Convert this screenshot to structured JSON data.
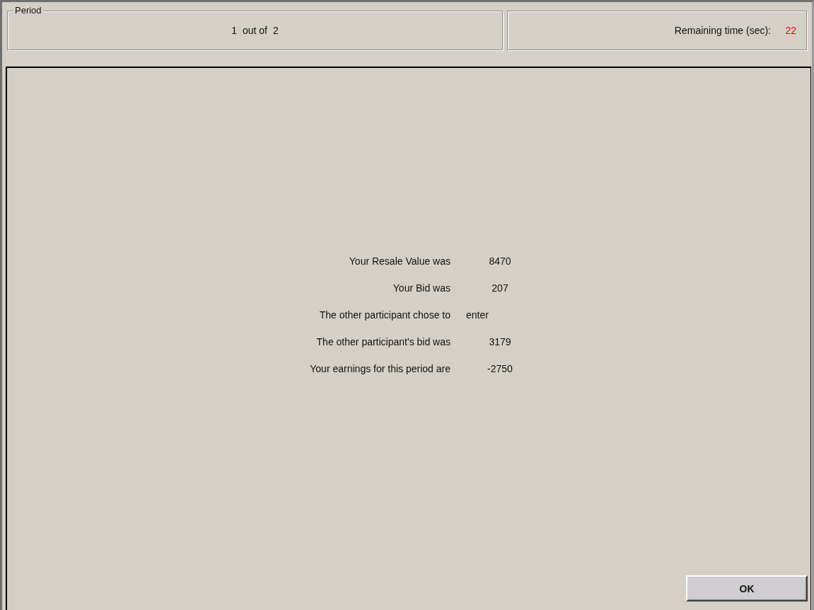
{
  "period": {
    "legend": "Period",
    "current": "1",
    "separator": "out of",
    "total": "2"
  },
  "timer": {
    "label": "Remaining time (sec):",
    "value": "22"
  },
  "results": [
    {
      "label": "Your Resale Value was",
      "value": "8470",
      "kind": "number"
    },
    {
      "label": "Your Bid was",
      "value": "207",
      "kind": "number"
    },
    {
      "label": "The other participant chose to",
      "value": "enter",
      "kind": "text"
    },
    {
      "label": "The other participant's bid was",
      "value": "3179",
      "kind": "number"
    },
    {
      "label": "Your earnings for this period are",
      "value": "-2750",
      "kind": "number"
    }
  ],
  "buttons": [
    "OK"
  ]
}
